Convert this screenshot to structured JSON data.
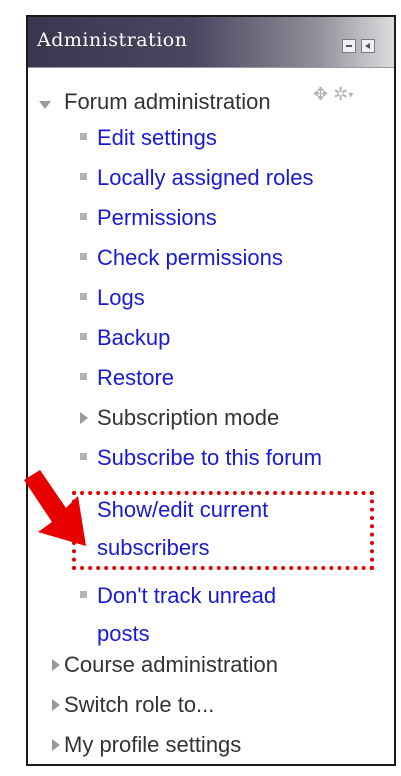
{
  "block": {
    "title": "Administration"
  },
  "forum_admin": {
    "label": "Forum administration",
    "items": [
      {
        "label": "Edit settings"
      },
      {
        "label": "Locally assigned roles"
      },
      {
        "label": "Permissions"
      },
      {
        "label": "Check permissions"
      },
      {
        "label": "Logs"
      },
      {
        "label": "Backup"
      },
      {
        "label": "Restore"
      }
    ],
    "subscription_mode": "Subscription mode",
    "subscribe": "Subscribe to this forum",
    "show_edit_line1": "Show/edit current",
    "show_edit_line2": "subscribers",
    "dont_track_line1": "Don't track unread",
    "dont_track_line2": "posts"
  },
  "other_nodes": [
    {
      "label": "Course administration"
    },
    {
      "label": "Switch role to..."
    },
    {
      "label": "My profile settings"
    }
  ],
  "colors": {
    "link": "#1a1ad6",
    "highlight": "#e00000",
    "text": "#333333"
  },
  "icons": {
    "move": "move-icon",
    "settings": "gear-icon",
    "minimize": "minimize-icon",
    "dock": "dock-icon",
    "pointer": "red-arrow-icon"
  }
}
